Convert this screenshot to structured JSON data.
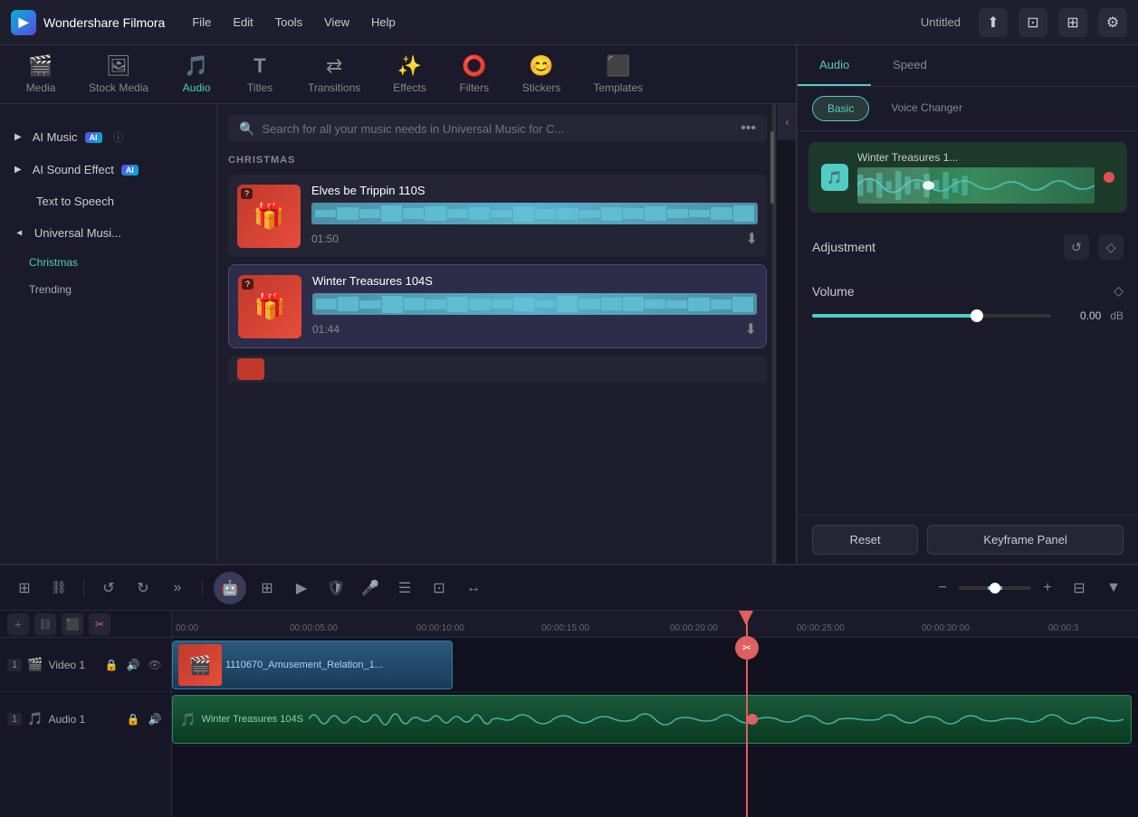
{
  "app": {
    "name": "Wondershare Filmora",
    "title": "Untitled",
    "logo_char": "▶"
  },
  "topbar": {
    "menu": [
      "File",
      "Edit",
      "Tools",
      "View",
      "Help"
    ],
    "icons": [
      "share-icon",
      "export-icon",
      "fullscreen-icon",
      "settings-icon"
    ]
  },
  "tool_nav": {
    "items": [
      {
        "id": "media",
        "label": "Media",
        "icon": "🎬",
        "active": false
      },
      {
        "id": "stock",
        "label": "Stock Media",
        "icon": "🖼",
        "active": false
      },
      {
        "id": "audio",
        "label": "Audio",
        "icon": "🎵",
        "active": true
      },
      {
        "id": "titles",
        "label": "Titles",
        "icon": "T",
        "active": false
      },
      {
        "id": "transitions",
        "label": "Transitions",
        "icon": "▷",
        "active": false
      },
      {
        "id": "effects",
        "label": "Effects",
        "icon": "✨",
        "active": false
      },
      {
        "id": "filters",
        "label": "Filters",
        "icon": "⭕",
        "active": false
      },
      {
        "id": "stickers",
        "label": "Stickers",
        "icon": "😊",
        "active": false
      },
      {
        "id": "templates",
        "label": "Templates",
        "icon": "⬛",
        "active": false
      }
    ]
  },
  "sidebar": {
    "items": [
      {
        "id": "ai-music",
        "label": "AI Music",
        "ai": true,
        "expandable": true,
        "info": true
      },
      {
        "id": "ai-sound",
        "label": "AI Sound Effect",
        "ai": true,
        "expandable": true
      },
      {
        "id": "tts",
        "label": "Text to Speech",
        "ai": false,
        "expandable": false
      },
      {
        "id": "universal",
        "label": "Universal Musi...",
        "ai": false,
        "expandable": true,
        "expanded": true
      }
    ],
    "sub_items": [
      {
        "id": "christmas",
        "label": "Christmas",
        "active": true
      },
      {
        "id": "trending",
        "label": "Trending",
        "active": false
      }
    ]
  },
  "search": {
    "placeholder": "Search for all your music needs in Universal Music for C...",
    "more_icon": "•••"
  },
  "music_section": {
    "label": "CHRISTMAS",
    "tracks": [
      {
        "id": "track1",
        "title": "Elves be Trippin 110S",
        "duration": "01:50",
        "selected": false
      },
      {
        "id": "track2",
        "title": "Winter Treasures 104S",
        "duration": "01:44",
        "selected": true
      }
    ]
  },
  "right_panel": {
    "tabs": [
      "Audio",
      "Speed"
    ],
    "active_tab": "Audio",
    "sub_tabs": [
      "Basic",
      "Voice Changer"
    ],
    "active_sub_tab": "Basic",
    "preview_title": "Winter Treasures 1...",
    "adjustment": {
      "label": "Adjustment",
      "reset_icon": "↺",
      "diamond_icon": "◇"
    },
    "volume": {
      "label": "Volume",
      "value": "0.00",
      "unit": "dB",
      "percent": 70
    },
    "buttons": {
      "reset": "Reset",
      "keyframe": "Keyframe Panel"
    }
  },
  "timeline": {
    "tools": [
      "⊞",
      "↺",
      "↻",
      "»",
      "🤖",
      "⊞",
      "▶",
      "🛡",
      "🎤",
      "☰",
      "⊡",
      "↔"
    ],
    "ruler_marks": [
      "00:00",
      "00:00:05:00",
      "00:00:10:00",
      "00:00:15:00",
      "00:00:20:00",
      "00:00:25:00",
      "00:00:30:00",
      "00:00:3"
    ],
    "playhead_time": "00:00:20:00",
    "tracks": [
      {
        "id": "video1",
        "type": "video",
        "label": "Video 1",
        "number": "1",
        "clip_title": "1110670_Amusement_Relation_1...",
        "clip_left": 0,
        "clip_width": 310
      },
      {
        "id": "audio1",
        "type": "audio",
        "label": "Audio 1",
        "number": "1",
        "clip_title": "Winter Treasures 104S",
        "clip_left": 0,
        "clip_width": 1050
      }
    ]
  }
}
